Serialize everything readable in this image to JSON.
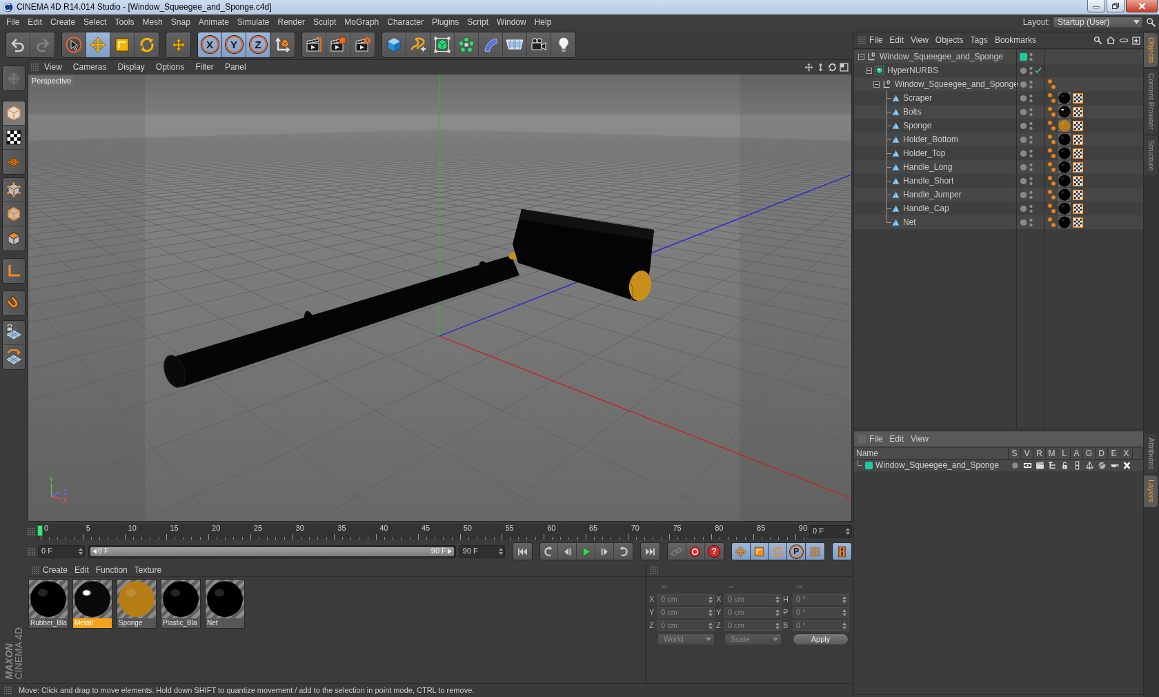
{
  "window": {
    "title": "CINEMA 4D R14.014 Studio - [Window_Squeegee_and_Sponge.c4d]"
  },
  "menu_bar": [
    "File",
    "Edit",
    "Create",
    "Select",
    "Tools",
    "Mesh",
    "Snap",
    "Animate",
    "Simulate",
    "Render",
    "Sculpt",
    "MoGraph",
    "Character",
    "Plugins",
    "Script",
    "Window",
    "Help"
  ],
  "layout": {
    "label": "Layout:",
    "value": "Startup (User)"
  },
  "toolbar": [
    [
      {
        "active": false,
        "disabled": false
      },
      {
        "active": false,
        "disabled": true
      }
    ],
    [
      {
        "active": false,
        "disabled": false
      },
      {
        "active": true,
        "disabled": false
      },
      {
        "active": false,
        "disabled": false
      },
      {
        "active": false,
        "disabled": false
      }
    ],
    [
      {
        "active": false,
        "disabled": false
      }
    ],
    [
      {
        "label": "X",
        "active": true,
        "disabled": false
      },
      {
        "label": "Y",
        "active": true,
        "disabled": false
      },
      {
        "label": "Z",
        "active": true,
        "disabled": false
      },
      {
        "active": false,
        "disabled": false
      }
    ],
    [
      {
        "active": false,
        "disabled": false
      },
      {
        "active": false,
        "disabled": false
      },
      {
        "active": false,
        "disabled": false
      }
    ],
    [
      {
        "active": false,
        "disabled": false
      },
      {
        "active": false,
        "disabled": false
      },
      {
        "active": false,
        "disabled": false
      },
      {
        "active": false,
        "disabled": false
      },
      {
        "active": false,
        "disabled": false
      },
      {
        "active": false,
        "disabled": false
      },
      {
        "active": false,
        "disabled": false
      },
      {
        "active": false,
        "disabled": false
      }
    ]
  ],
  "mode_toolbar": [
    [
      {
        "active": false,
        "disabled": true
      }
    ],
    [
      {
        "active": true,
        "disabled": false
      },
      {
        "active": false,
        "disabled": false
      },
      {
        "active": false,
        "disabled": false
      }
    ],
    [
      {
        "active": false,
        "disabled": false
      },
      {
        "active": false,
        "disabled": false
      },
      {
        "active": false,
        "disabled": false
      }
    ],
    [
      {
        "active": false,
        "disabled": false
      }
    ],
    [
      {
        "active": false,
        "disabled": false
      }
    ],
    [
      {
        "active": false,
        "disabled": false
      },
      {
        "active": false,
        "disabled": false
      }
    ]
  ],
  "viewport": {
    "menu": [
      "View",
      "Cameras",
      "Display",
      "Options",
      "Filter",
      "Panel"
    ],
    "camera": "Perspective",
    "gizmo_labels": [
      "Y",
      "Z",
      "X"
    ]
  },
  "timeline": {
    "ticks": [
      "0",
      "5",
      "10",
      "15",
      "20",
      "25",
      "30",
      "35",
      "40",
      "45",
      "50",
      "55",
      "60",
      "65",
      "70",
      "75",
      "80",
      "85",
      "90"
    ],
    "level": 0,
    "frame": "0 F"
  },
  "transport": {
    "start": "0 F",
    "range": {
      "start": "0 F",
      "end": "90 F",
      "level": 1
    },
    "end": "90 F",
    "buttons": [
      [
        {
          "active": false,
          "disabled": false
        }
      ],
      [
        {
          "active": false,
          "disabled": false
        },
        {
          "active": false,
          "disabled": false
        },
        {
          "active": false,
          "disabled": false
        },
        {
          "active": false,
          "disabled": false
        },
        {
          "active": false,
          "disabled": false
        }
      ],
      [
        {
          "active": false,
          "disabled": false
        }
      ],
      [
        {
          "active": false,
          "disabled": true
        },
        {
          "active": false,
          "disabled": false
        },
        {
          "label": "?",
          "active": false,
          "disabled": false
        }
      ],
      [
        {
          "active": true,
          "disabled": false
        },
        {
          "active": true,
          "disabled": false
        },
        {
          "active": true,
          "disabled": false
        },
        {
          "label": "P",
          "active": true,
          "disabled": false
        },
        {
          "active": true,
          "disabled": false
        }
      ],
      [
        {
          "active": true,
          "disabled": false
        }
      ]
    ]
  },
  "materials": {
    "menu": [
      "Create",
      "Edit",
      "Function",
      "Texture"
    ],
    "items": [
      {
        "name": "Rubber_Bla",
        "selected": false,
        "color": "#000000",
        "glossy": false
      },
      {
        "name": "Metall",
        "selected": true,
        "color": "#0a0a0a",
        "glossy": true
      },
      {
        "name": "Sponge",
        "selected": false,
        "color": "#b67c16",
        "glossy": false
      },
      {
        "name": "Plastic_Bla",
        "selected": false,
        "color": "#000000",
        "glossy": false
      },
      {
        "name": "Net",
        "selected": false,
        "color": "#000000",
        "glossy": false
      }
    ]
  },
  "coordinates": {
    "headers": [
      "--",
      "--",
      "--"
    ],
    "rows": [
      [
        {
          "label": "X",
          "value": "0 cm"
        },
        {
          "label": "X",
          "value": "0 cm"
        },
        {
          "label": "H",
          "value": "0 °"
        }
      ],
      [
        {
          "label": "Y",
          "value": "0 cm"
        },
        {
          "label": "Y",
          "value": "0 cm"
        },
        {
          "label": "P",
          "value": "0 °"
        }
      ],
      [
        {
          "label": "Z",
          "value": "0 cm"
        },
        {
          "label": "Z",
          "value": "0 cm"
        },
        {
          "label": "B",
          "value": "0 °"
        }
      ]
    ],
    "dropdowns": [
      "World",
      "Scale"
    ],
    "apply": "Apply"
  },
  "status_bar": "Move: Click and drag to move elements. Hold down SHIFT to quantize movement / add to the selection in point mode, CTRL to remove.",
  "logo": {
    "brand": "MAXON",
    "product": "CINEMA 4D"
  },
  "objects": {
    "menu": [
      "File",
      "Edit",
      "View",
      "Objects",
      "Tags",
      "Bookmarks"
    ],
    "tree": [
      {
        "name": "Window_Squeegee_and_Sponge",
        "kind": "null",
        "expanded": true,
        "color": "#1cc9a0",
        "children": [
          {
            "name": "HyperNURBS",
            "kind": "hypernurbs",
            "expanded": true,
            "enabled": true,
            "children": [
              {
                "name": "Window_Squeegee_and_Sponge",
                "kind": "null",
                "expanded": true,
                "tags": [
                  {
                    "kind": "phong"
                  }
                ],
                "children": [
                  {
                    "name": "Scraper",
                    "kind": "polygon",
                    "tags": [
                      {
                        "kind": "phong"
                      },
                      {
                        "kind": "material",
                        "color": "#000000",
                        "glossy": false
                      },
                      {
                        "kind": "uvw"
                      }
                    ]
                  },
                  {
                    "name": "Bolts",
                    "kind": "polygon",
                    "tags": [
                      {
                        "kind": "phong"
                      },
                      {
                        "kind": "material",
                        "color": "#0a0a0a",
                        "glossy": true
                      },
                      {
                        "kind": "uvw"
                      }
                    ]
                  },
                  {
                    "name": "Sponge",
                    "kind": "polygon",
                    "tags": [
                      {
                        "kind": "phong"
                      },
                      {
                        "kind": "material",
                        "color": "#b67c16",
                        "glossy": false
                      },
                      {
                        "kind": "uvw"
                      }
                    ]
                  },
                  {
                    "name": "Holder_Bottom",
                    "kind": "polygon",
                    "tags": [
                      {
                        "kind": "phong"
                      },
                      {
                        "kind": "material",
                        "color": "#000000",
                        "glossy": false
                      },
                      {
                        "kind": "uvw"
                      }
                    ]
                  },
                  {
                    "name": "Holder_Top",
                    "kind": "polygon",
                    "tags": [
                      {
                        "kind": "phong"
                      },
                      {
                        "kind": "material",
                        "color": "#000000",
                        "glossy": false
                      },
                      {
                        "kind": "uvw"
                      }
                    ]
                  },
                  {
                    "name": "Handle_Long",
                    "kind": "polygon",
                    "tags": [
                      {
                        "kind": "phong"
                      },
                      {
                        "kind": "material",
                        "color": "#000000",
                        "glossy": false
                      },
                      {
                        "kind": "uvw"
                      }
                    ]
                  },
                  {
                    "name": "Handle_Short",
                    "kind": "polygon",
                    "tags": [
                      {
                        "kind": "phong"
                      },
                      {
                        "kind": "material",
                        "color": "#000000",
                        "glossy": false
                      },
                      {
                        "kind": "uvw"
                      }
                    ]
                  },
                  {
                    "name": "Handle_Jumper",
                    "kind": "polygon",
                    "tags": [
                      {
                        "kind": "phong"
                      },
                      {
                        "kind": "material",
                        "color": "#000000",
                        "glossy": false
                      },
                      {
                        "kind": "uvw"
                      }
                    ]
                  },
                  {
                    "name": "Handle_Cap",
                    "kind": "polygon",
                    "tags": [
                      {
                        "kind": "phong"
                      },
                      {
                        "kind": "material",
                        "color": "#000000",
                        "glossy": false
                      },
                      {
                        "kind": "uvw"
                      }
                    ]
                  },
                  {
                    "name": "Net",
                    "kind": "polygon",
                    "tags": [
                      {
                        "kind": "phong"
                      },
                      {
                        "kind": "material",
                        "color": "#000000",
                        "glossy": false
                      },
                      {
                        "kind": "uvw"
                      }
                    ]
                  }
                ]
              }
            ]
          }
        ]
      }
    ]
  },
  "layers": {
    "menu": [
      "File",
      "Edit",
      "View"
    ],
    "columns": [
      "Name",
      "S",
      "V",
      "R",
      "M",
      "L",
      "A",
      "G",
      "D",
      "E",
      "X"
    ],
    "rows": [
      {
        "name": "Window_Squeegee_and_Sponge",
        "color": "#1cc9a0"
      }
    ]
  },
  "side_tabs_top": [
    {
      "label": "Objects",
      "selected": true
    },
    {
      "label": "Content Browser",
      "selected": false
    },
    {
      "label": "Structure",
      "selected": false
    }
  ],
  "side_tabs_bottom": [
    {
      "label": "Attributes",
      "selected": false
    },
    {
      "label": "Layers",
      "selected": true
    }
  ]
}
